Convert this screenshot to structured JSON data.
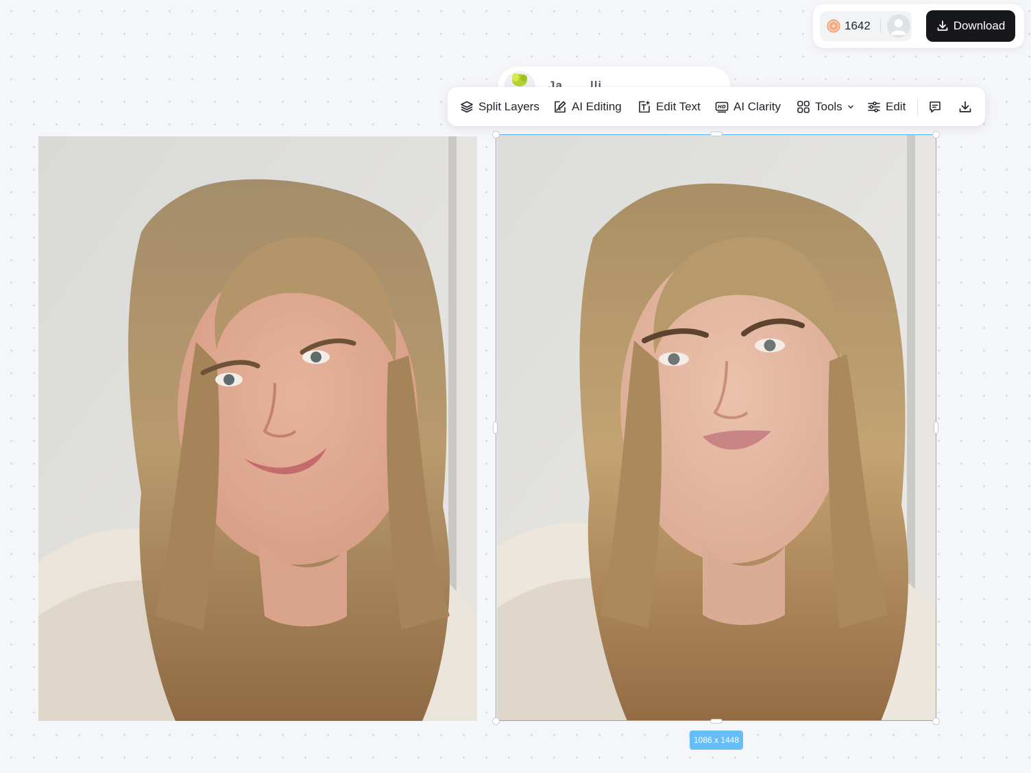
{
  "account": {
    "credits": "1642",
    "download_label": "Download",
    "coin_icon": "coin-icon",
    "avatar_icon": "user-avatar-icon"
  },
  "ghost_card": {
    "name": "Ja... ...lli..."
  },
  "toolbar": {
    "items": [
      {
        "label": "Split Layers",
        "icon": "layers-icon"
      },
      {
        "label": "AI Editing",
        "icon": "ai-edit-icon"
      },
      {
        "label": "Edit Text",
        "icon": "text-edit-icon"
      },
      {
        "label": "AI Clarity",
        "icon": "hd-icon"
      },
      {
        "label": "Tools",
        "icon": "grid-icon"
      },
      {
        "label": "Edit",
        "icon": "sliders-icon"
      }
    ],
    "comment_icon": "comment-icon",
    "download_icon": "download-icon"
  },
  "canvas": {
    "selected_size": "1086 x 1448"
  },
  "colors": {
    "accent": "#5fb2f6",
    "badge": "#66bdf7",
    "dark_button": "#16181c"
  }
}
